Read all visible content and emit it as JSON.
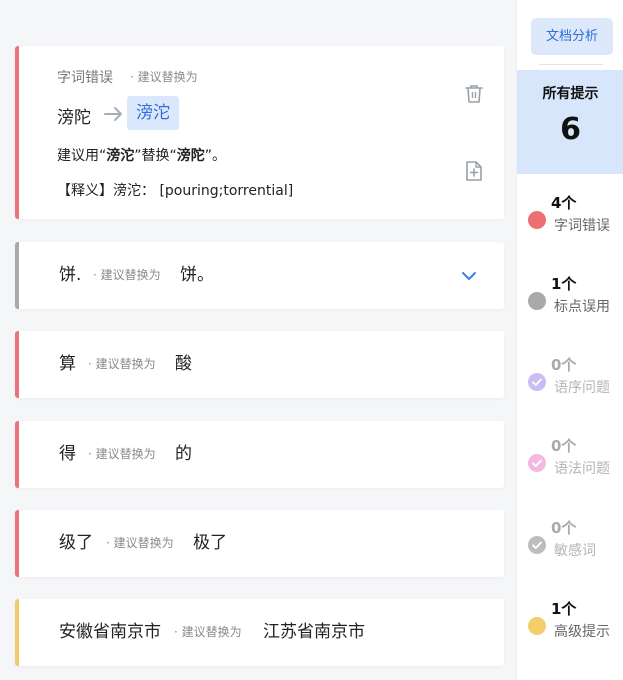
{
  "expanded": {
    "category": "字词错误",
    "hint": "· 建议替换为",
    "original": "滂陀",
    "suggestion": "滂沱",
    "advice_prefix": "建议用“",
    "advice_suggestion": "滂沱",
    "advice_mid": "”替换“",
    "advice_original": "滂陀",
    "advice_suffix": "”。",
    "definition": "【释义】滂沱： [pouring;torrential]",
    "accent": "#e8757a"
  },
  "items": [
    {
      "original": "饼.",
      "hint": "· 建议替换为",
      "suggestion": "饼。",
      "accent": "#aaaaaa"
    },
    {
      "original": "算",
      "hint": "· 建议替换为",
      "suggestion": "酸",
      "accent": "#e8757a"
    },
    {
      "original": "得",
      "hint": "· 建议替换为",
      "suggestion": "的",
      "accent": "#e8757a"
    },
    {
      "original": "级了",
      "hint": "· 建议替换为",
      "suggestion": "极了",
      "accent": "#e8757a"
    },
    {
      "original": "安徽省南京市",
      "hint": "· 建议替换为",
      "suggestion": "江苏省南京市",
      "accent": "#f2cc6b"
    }
  ],
  "sidebar": {
    "analyze_button": "文档分析",
    "all_label": "所有提示",
    "all_count": "6",
    "stats": [
      {
        "count": "4个",
        "label": "字词错误",
        "color": "#ec6f72",
        "icon": "dot"
      },
      {
        "count": "1个",
        "label": "标点误用",
        "color": "#a9a9a9",
        "icon": "dot"
      },
      {
        "count": "0个",
        "label": "语序问题",
        "color": "#c9bdf3",
        "icon": "check"
      },
      {
        "count": "0个",
        "label": "语法问题",
        "color": "#f3b9e2",
        "icon": "check"
      },
      {
        "count": "0个",
        "label": "敏感词",
        "color": "#bdbdbd",
        "icon": "check"
      },
      {
        "count": "1个",
        "label": "高级提示",
        "color": "#f3cf6a",
        "icon": "dot"
      }
    ]
  }
}
